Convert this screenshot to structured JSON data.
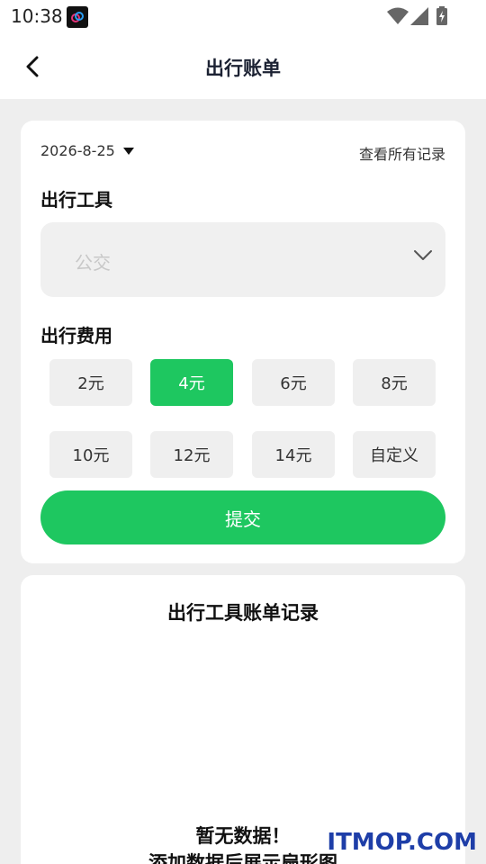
{
  "status_bar": {
    "time": "10:38",
    "icons": [
      "app-notification-icon",
      "wifi-icon",
      "signal-icon",
      "battery-charging-icon"
    ]
  },
  "header": {
    "title": "出行账单",
    "back_icon": "chevron-left-icon"
  },
  "form": {
    "date": "2026-8-25",
    "view_all_label": "查看所有记录",
    "tool_section_label": "出行工具",
    "tool_select": {
      "value": "公交",
      "icon": "chevron-down-icon"
    },
    "fee_section_label": "出行费用",
    "fee_options": [
      {
        "label": "2元",
        "selected": false
      },
      {
        "label": "4元",
        "selected": true
      },
      {
        "label": "6元",
        "selected": false
      },
      {
        "label": "8元",
        "selected": false
      },
      {
        "label": "10元",
        "selected": false
      },
      {
        "label": "12元",
        "selected": false
      },
      {
        "label": "14元",
        "selected": false
      },
      {
        "label": "自定义",
        "selected": false
      }
    ],
    "submit_label": "提交"
  },
  "records": {
    "title": "出行工具账单记录",
    "empty_line1": "暂无数据！",
    "empty_line2": "添加数据后展示扇形图"
  },
  "watermark": "ITMOP.COM",
  "colors": {
    "accent": "#1ec760",
    "background": "#eeeeee",
    "card": "#ffffff",
    "title_text": "#1c2233"
  }
}
